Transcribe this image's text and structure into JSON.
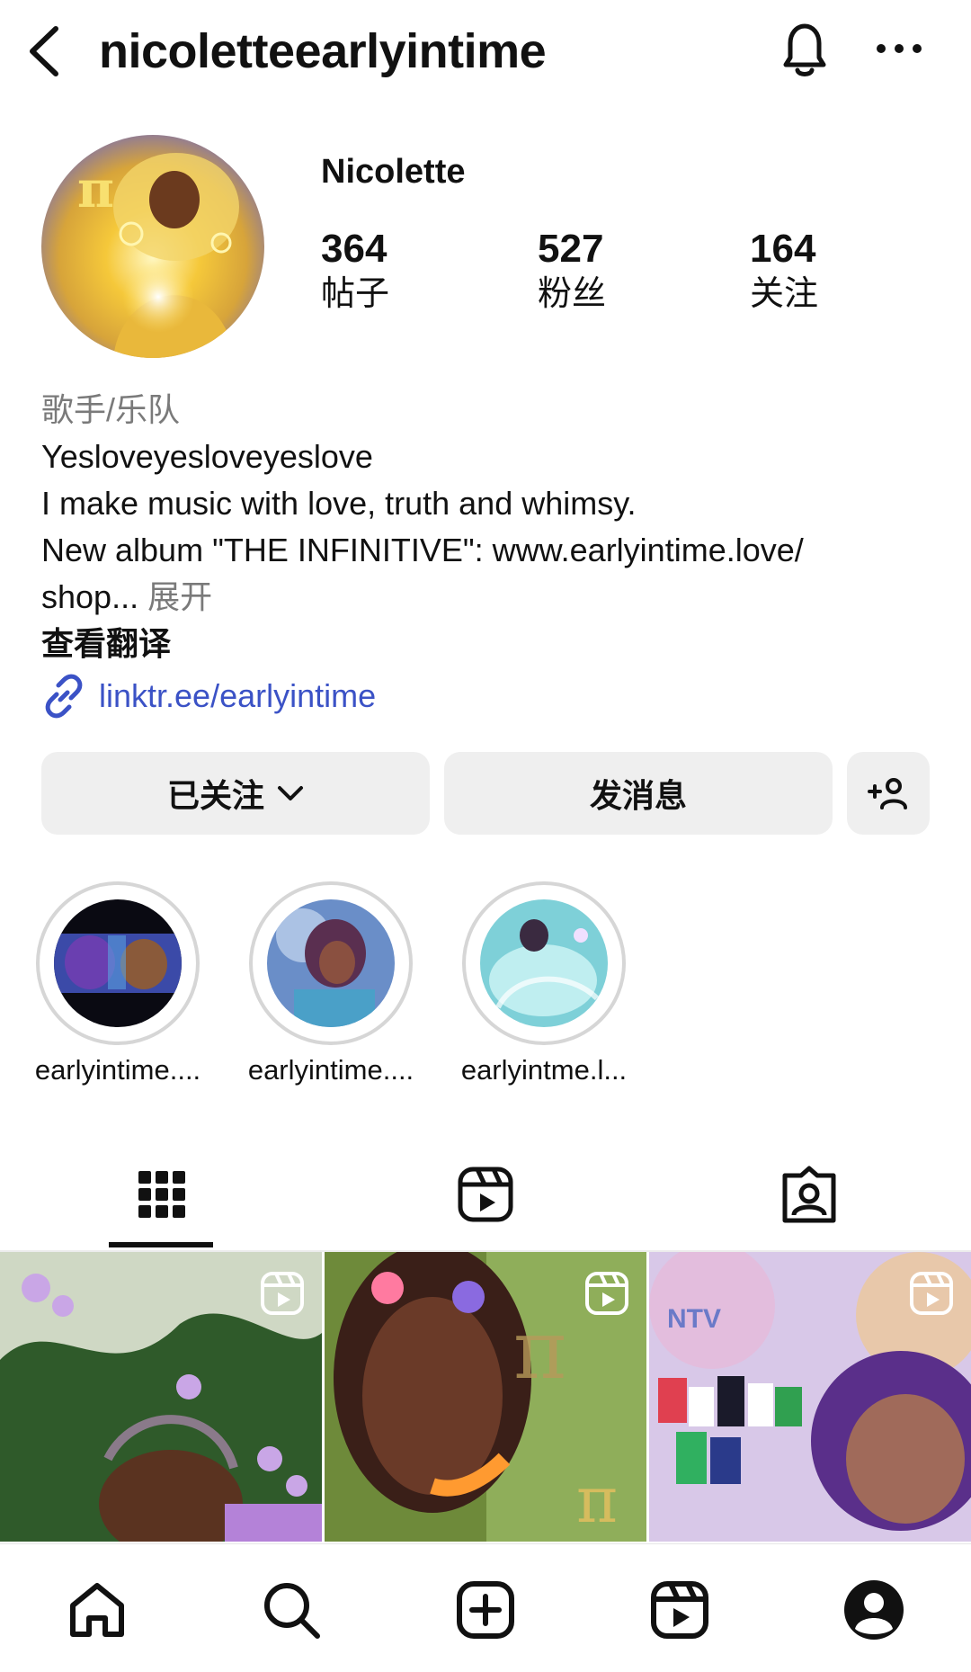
{
  "header": {
    "back_icon": "back-arrow-icon",
    "username": "nicoletteearlyintime",
    "bell_icon": "bell-icon",
    "more_icon": "more-horizontal-icon"
  },
  "profile": {
    "name": "Nicolette",
    "stats": [
      {
        "value": "364",
        "label": "帖子"
      },
      {
        "value": "527",
        "label": "粉丝"
      },
      {
        "value": "164",
        "label": "关注"
      }
    ]
  },
  "bio": {
    "category": "歌手/乐队",
    "line1": "Yesloveyesloveyeslove",
    "line2": "I make music with love, truth and whimsy.",
    "line3": "New album \"THE INFINITIVE\": www.earlyintime.love/",
    "line4": "shop...",
    "expand": "展开",
    "translate": "查看翻译",
    "link": "linktr.ee/earlyintime"
  },
  "actions": {
    "following": "已关注",
    "message": "发消息"
  },
  "highlights": [
    {
      "label": "earlyintime...."
    },
    {
      "label": "earlyintime...."
    },
    {
      "label": "earlyintme.l..."
    }
  ],
  "tabs": [
    "grid-icon",
    "reels-icon",
    "tagged-icon"
  ],
  "grid_thumbs": [
    {
      "caption": ""
    },
    {
      "caption": ""
    },
    {
      "caption": "NTV"
    }
  ],
  "colors": {
    "link": "#3b52c6",
    "button_bg": "#efefef",
    "muted": "#7a7a7a"
  },
  "nav": [
    "home-icon",
    "search-icon",
    "create-icon",
    "reels-icon",
    "profile-icon"
  ]
}
